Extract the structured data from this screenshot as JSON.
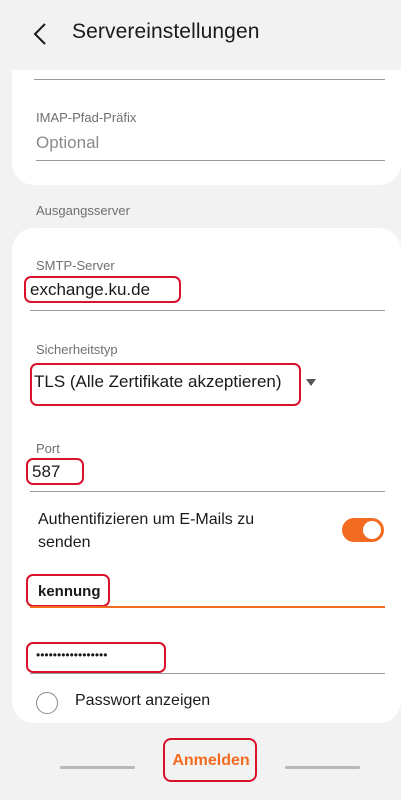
{
  "header": {
    "title": "Servereinstellungen"
  },
  "imap": {
    "prefix_label": "IMAP-Pfad-Präfix",
    "prefix_placeholder": "Optional"
  },
  "outgoing": {
    "section_title": "Ausgangsserver",
    "smtp_label": "SMTP-Server",
    "smtp_value": "exchange.ku.de",
    "security_label": "Sicherheitstyp",
    "security_value": "TLS (Alle Zertifikate akzeptieren)",
    "port_label": "Port",
    "port_value": "587",
    "auth_label_line1": "Authentifizieren um E-Mails zu",
    "auth_label_line2": "senden",
    "auth_enabled": true,
    "username_value": "kennung",
    "password_value": "•••••••••••••••••",
    "show_password_label": "Passwort anzeigen"
  },
  "actions": {
    "login_label": "Anmelden"
  },
  "colors": {
    "accent": "#f26b21",
    "highlight": "#d8132b",
    "background": "#f2f2f2"
  }
}
